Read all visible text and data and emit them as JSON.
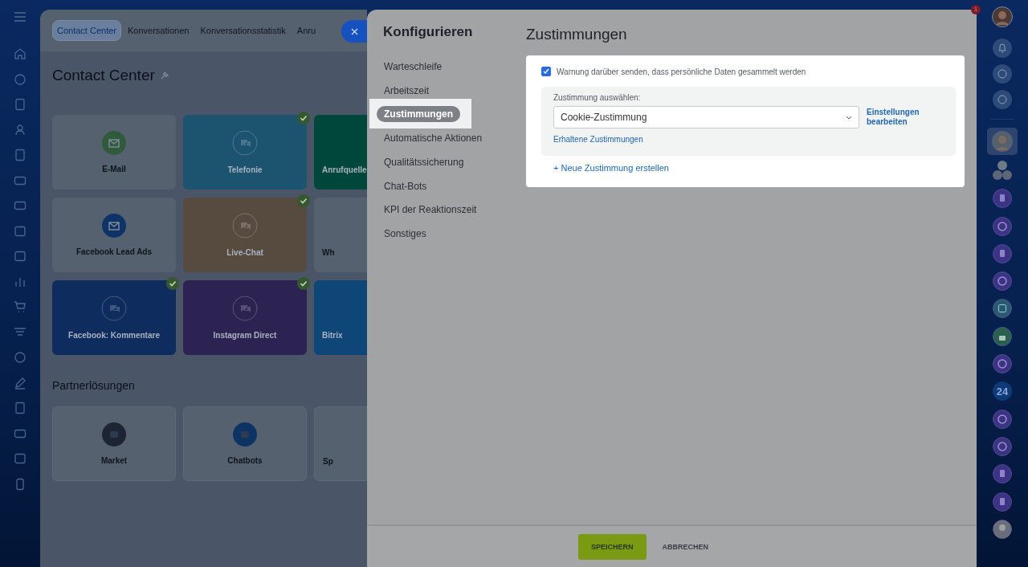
{
  "notification_badge": "1",
  "background_page": {
    "tabs": [
      {
        "label": "Contact Center",
        "selected": true
      },
      {
        "label": "Konversationen",
        "selected": false
      },
      {
        "label": "Konversationsstatistik",
        "selected": false
      },
      {
        "label": "Anru",
        "selected": false
      }
    ],
    "title": "Contact Center",
    "tiles": [
      {
        "label": "E-Mail",
        "kind": "light",
        "cut": false,
        "color": "#56616f",
        "connected": false
      },
      {
        "label": "Telefonie",
        "kind": "colored",
        "cut": false,
        "color": "#1c5470",
        "connected": true
      },
      {
        "label": "Anrufquelle",
        "kind": "colored",
        "cut": true,
        "color": "#00473b",
        "connected": false
      },
      {
        "label": "Facebook Lead Ads",
        "kind": "light",
        "cut": false,
        "color": "#56616f",
        "connected": false
      },
      {
        "label": "Live-Chat",
        "kind": "colored",
        "cut": false,
        "color": "#574a3e",
        "connected": true
      },
      {
        "label": "Wh",
        "kind": "light",
        "cut": true,
        "color": "#56616f",
        "connected": false
      },
      {
        "label": "Facebook: Kommentare",
        "kind": "colored",
        "cut": false,
        "color": "#0f2c5e",
        "connected": true
      },
      {
        "label": "Instagram Direct",
        "kind": "colored",
        "cut": false,
        "color": "#2c2352",
        "connected": true
      },
      {
        "label": "Bitrix",
        "kind": "colored",
        "cut": true,
        "color": "#0e4677",
        "connected": false
      }
    ],
    "partner_title": "Partnerlösungen",
    "partner_tiles": [
      {
        "label": "Market",
        "cut": false
      },
      {
        "label": "Chatbots",
        "cut": false
      },
      {
        "label": "Sp",
        "cut": true
      }
    ]
  },
  "slider": {
    "title": "Konfigurieren",
    "menu": [
      {
        "label": "Warteschleife",
        "selected": false
      },
      {
        "label": "Arbeitszeit",
        "selected": false
      },
      {
        "label": "Zustimmungen",
        "selected": true
      },
      {
        "label": "Automatische Aktionen",
        "selected": false
      },
      {
        "label": "Qualitätssicherung",
        "selected": false
      },
      {
        "label": "Chat-Bots",
        "selected": false
      },
      {
        "label": "KPI der Reaktionszeit",
        "selected": false
      },
      {
        "label": "Sonstiges",
        "selected": false
      }
    ],
    "section_title": "Zustimmungen",
    "warning": {
      "label": "Warnung darüber senden, dass persönliche Daten gesammelt werden",
      "checked": true
    },
    "consent_select": {
      "label": "Zustimmung auswählen:",
      "value": "Cookie-Zustimmung"
    },
    "edit_link": "Einstellungen bearbeiten",
    "received_link": "Erhaltene Zustimmungen",
    "create_link": "+ Neue Zustimmung erstellen",
    "buttons": [
      {
        "label": "SPEICHERN",
        "kind": "primary"
      },
      {
        "label": "ABBRECHEN",
        "kind": "secondary"
      }
    ]
  },
  "right_rail": {
    "badge_text": "24"
  }
}
